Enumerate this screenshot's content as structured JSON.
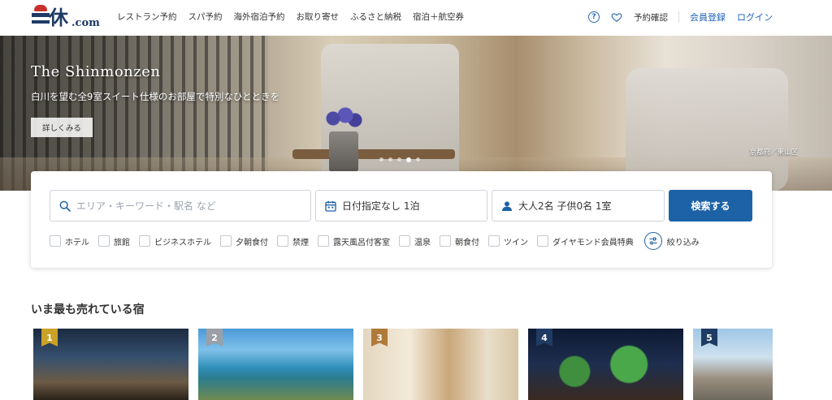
{
  "header": {
    "logo_kanji": "休",
    "logo_suffix": ".com",
    "nav": [
      "レストラン予約",
      "スパ予約",
      "海外宿泊予約",
      "お取り寄せ",
      "ふるさと納税",
      "宿泊＋航空券"
    ],
    "help_label": "?",
    "reservation_check": "予約確認",
    "register": "会員登録",
    "login": "ログイン"
  },
  "hero": {
    "title": "The Shinmonzen",
    "subtitle": "白川を望む全9室スイート仕様のお部屋で特別なひとときを",
    "button": "詳しくみる",
    "credit": "京都府／東山区",
    "slide_count": 5,
    "active_slide": 4
  },
  "search": {
    "keyword_placeholder": "エリア・キーワード・駅名 など",
    "date_value": "日付指定なし 1泊",
    "guests_value": "大人2名 子供0名 1室",
    "submit": "検索する",
    "filters": [
      "ホテル",
      "旅館",
      "ビジネスホテル",
      "夕朝食付",
      "禁煙",
      "露天風呂付客室",
      "温泉",
      "朝食付",
      "ツイン",
      "ダイヤモンド会員特典"
    ],
    "narrow_label": "絞り込み"
  },
  "ranking": {
    "title": "いま最も売れている宿",
    "items": [
      {
        "rank": "1"
      },
      {
        "rank": "2"
      },
      {
        "rank": "3"
      },
      {
        "rank": "4"
      },
      {
        "rank": "5"
      }
    ]
  },
  "colors": {
    "brand": "#1f3b64",
    "link_blue": "#1d62b5",
    "search_button": "#1d62a6"
  }
}
